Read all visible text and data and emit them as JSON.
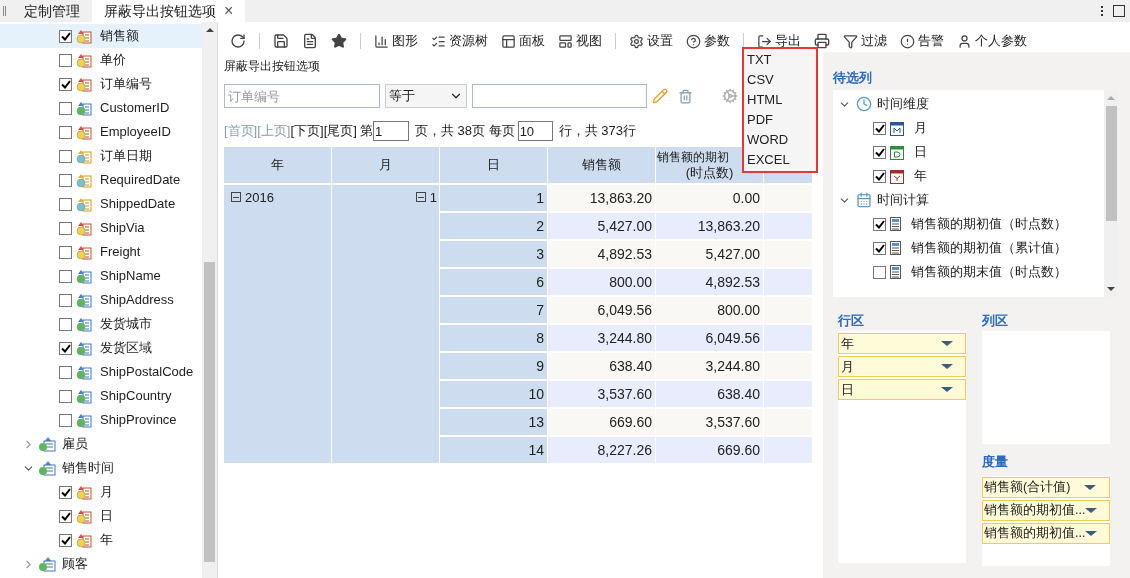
{
  "tabs": [
    {
      "label": "定制管理",
      "selected": false
    },
    {
      "label": "屏蔽导出按钮选项",
      "selected": true,
      "close": "×"
    }
  ],
  "field_tree": {
    "fields": [
      {
        "label": "销售额",
        "checked": true,
        "selected": true,
        "kind": "measure"
      },
      {
        "label": "单价",
        "checked": false,
        "selected": false,
        "kind": "measure"
      },
      {
        "label": "订单编号",
        "checked": true,
        "selected": false,
        "kind": "measure"
      },
      {
        "label": "CustomerID",
        "checked": false,
        "selected": false,
        "kind": "dimension"
      },
      {
        "label": "EmployeeID",
        "checked": false,
        "selected": false,
        "kind": "measure"
      },
      {
        "label": "订单日期",
        "checked": false,
        "selected": false,
        "kind": "date"
      },
      {
        "label": "RequiredDate",
        "checked": false,
        "selected": false,
        "kind": "date"
      },
      {
        "label": "ShippedDate",
        "checked": false,
        "selected": false,
        "kind": "date"
      },
      {
        "label": "ShipVia",
        "checked": false,
        "selected": false,
        "kind": "measure"
      },
      {
        "label": "Freight",
        "checked": false,
        "selected": false,
        "kind": "measure"
      },
      {
        "label": "ShipName",
        "checked": false,
        "selected": false,
        "kind": "dimension"
      },
      {
        "label": "ShipAddress",
        "checked": false,
        "selected": false,
        "kind": "dimension"
      },
      {
        "label": "发货城市",
        "checked": false,
        "selected": false,
        "kind": "dimension"
      },
      {
        "label": "发货区域",
        "checked": true,
        "selected": false,
        "kind": "dimension"
      },
      {
        "label": "ShipPostalCode",
        "checked": false,
        "selected": false,
        "kind": "dimension"
      },
      {
        "label": "ShipCountry",
        "checked": false,
        "selected": false,
        "kind": "dimension"
      },
      {
        "label": "ShipProvince",
        "checked": false,
        "selected": false,
        "kind": "dimension"
      }
    ],
    "groups": [
      {
        "label": "雇员",
        "expanded": false
      },
      {
        "label": "销售时间",
        "expanded": true,
        "children": [
          {
            "label": "月",
            "checked": true
          },
          {
            "label": "日",
            "checked": true
          },
          {
            "label": "年",
            "checked": true
          }
        ]
      },
      {
        "label": "顾客",
        "expanded": false
      }
    ]
  },
  "toolbar": [
    {
      "kind": "refresh"
    },
    {
      "kind": "save"
    },
    {
      "kind": "save-as"
    },
    {
      "kind": "star"
    },
    {
      "kind": "chart",
      "label": "图形"
    },
    {
      "kind": "tree",
      "label": "资源树"
    },
    {
      "kind": "panel",
      "label": "面板"
    },
    {
      "kind": "view",
      "label": "视图"
    },
    {
      "kind": "settings",
      "label": "设置"
    },
    {
      "kind": "help",
      "label": "参数"
    },
    {
      "kind": "export",
      "label": "导出"
    },
    {
      "kind": "print"
    },
    {
      "kind": "filter",
      "label": "过滤"
    },
    {
      "kind": "alert",
      "label": "告警"
    },
    {
      "kind": "user",
      "label": "个人参数"
    }
  ],
  "report_title": "屏蔽导出按钮选项",
  "filter": {
    "placeholder": "订单编号",
    "operator": "等于"
  },
  "pager": {
    "links": [
      "[首页]",
      "[上页]",
      "[下页]",
      "[尾页]"
    ],
    "enabled": [
      false,
      false,
      true,
      true
    ],
    "page_label": "第",
    "page": "1",
    "total_pages": "页，共 38页 每页",
    "page_size": "10",
    "total_rows": "行，共 373行"
  },
  "table": {
    "columns": [
      "年",
      "月",
      "日",
      "销售额",
      [
        "销售额的期初",
        "(时点数)"
      ]
    ],
    "year": "2016",
    "month": "1",
    "rows": [
      [
        "1",
        "13,863.20",
        "0.00"
      ],
      [
        "2",
        "5,427.00",
        "13,863.20"
      ],
      [
        "3",
        "4,892.53",
        "5,427.00"
      ],
      [
        "6",
        "800.00",
        "4,892.53"
      ],
      [
        "7",
        "6,049.56",
        "800.00"
      ],
      [
        "8",
        "3,244.80",
        "6,049.56"
      ],
      [
        "9",
        "638.40",
        "3,244.80"
      ],
      [
        "10",
        "3,537.60",
        "638.40"
      ],
      [
        "13",
        "669.60",
        "3,537.60"
      ],
      [
        "14",
        "8,227.26",
        "669.60"
      ]
    ]
  },
  "export_menu": [
    "TXT",
    "CSV",
    "HTML",
    "PDF",
    "WORD",
    "EXCEL"
  ],
  "right_panel": {
    "candidates_title": "待选列",
    "candidates": [
      {
        "label": "时间维度",
        "kind": "time",
        "expanded": true,
        "children": [
          {
            "label": "月",
            "kind": "month",
            "checked": true
          },
          {
            "label": "日",
            "kind": "day",
            "checked": true
          },
          {
            "label": "年",
            "kind": "year",
            "checked": true
          }
        ]
      },
      {
        "label": "时间计算",
        "kind": "calc",
        "expanded": true,
        "children": [
          {
            "label": "销售额的期初值（时点数）",
            "kind": "measure",
            "checked": true
          },
          {
            "label": "销售额的期初值（累计值）",
            "kind": "measure",
            "checked": true
          },
          {
            "label": "销售额的期末值（时点数）",
            "kind": "measure",
            "checked": false
          }
        ]
      }
    ],
    "rows_title": "行区",
    "rows": [
      "年",
      "月",
      "日"
    ],
    "columns_title": "列区",
    "measures_title": "度量",
    "measures": [
      "销售额(合计值)",
      "销售额的期初值...",
      "销售额的期初值..."
    ]
  }
}
